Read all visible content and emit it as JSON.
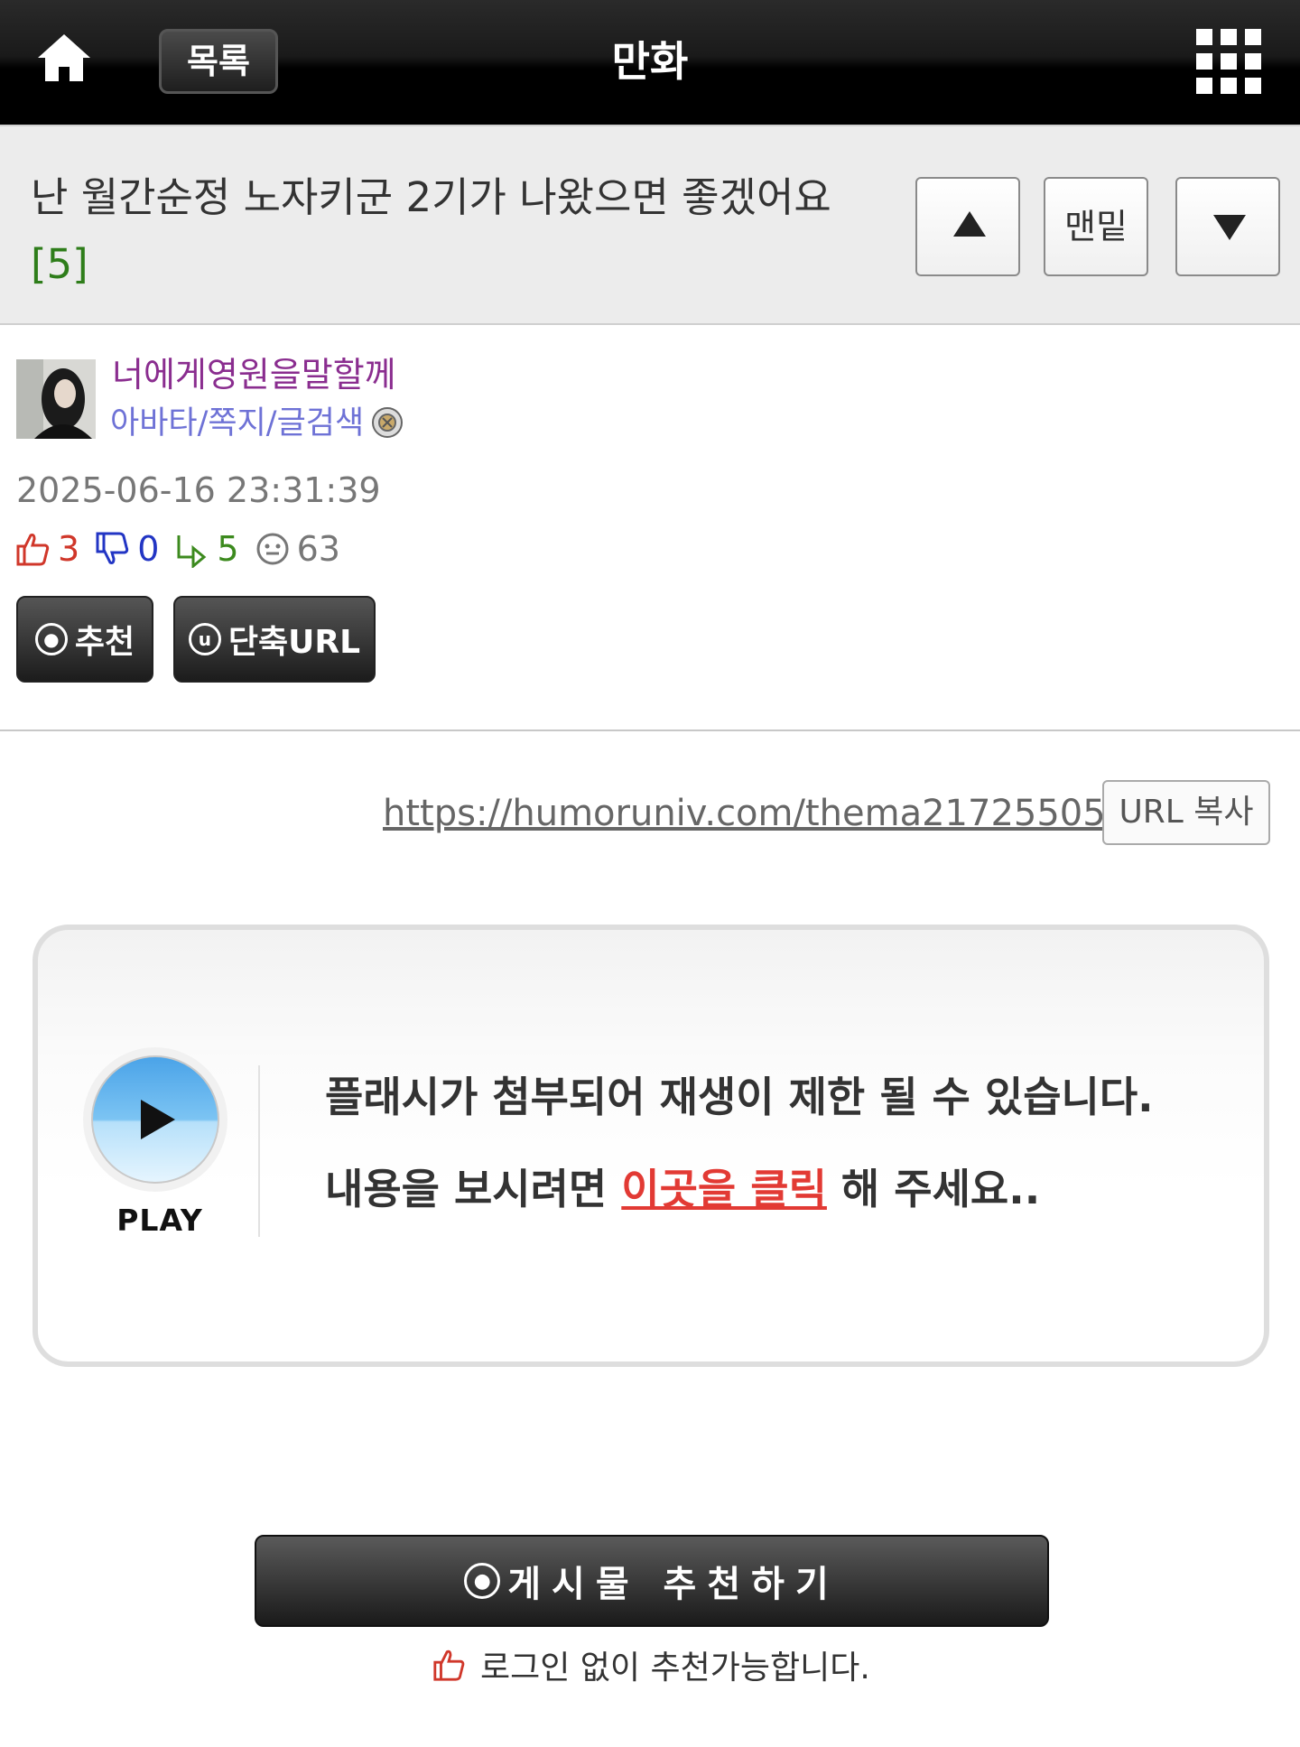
{
  "nav": {
    "title": "만화",
    "list_label": "목록",
    "home_icon": "home-icon",
    "menu_icon": "grid-menu-icon"
  },
  "post": {
    "title": "난 월간순정 노자키군 2기가 나왔으면 좋겠어요",
    "comment_count": "[5]",
    "bottom_label": "맨밑",
    "author": "너에게영원을말할께",
    "author_links": "아바타/쪽지/글검색",
    "date": "2025-06-16 23:31:39",
    "stats": {
      "up": "3",
      "down": "0",
      "reply": "5",
      "views": "63"
    },
    "recommend_label": "추천",
    "short_url_label": "단축URL",
    "url": "https://humoruniv.com/thema21725505",
    "url_copy_label": "URL 복사"
  },
  "flash": {
    "play_label": "PLAY",
    "line1": "플래시가 첨부되어 재생이 제한 될 수 있습니다.",
    "line2_before": "내용을 보시려면 ",
    "line2_link": "이곳을 클릭",
    "line2_after": " 해 주세요.."
  },
  "recommend": {
    "button_label": "게시물 추천하기",
    "note": "로그인 없이 추천가능합니다."
  },
  "colors": {
    "author": "#8a2d8f",
    "links": "#6e72d6",
    "up": "#d0372a",
    "down": "#2235c4",
    "reply": "#3c8a1e",
    "flash_link": "#e23a34"
  }
}
